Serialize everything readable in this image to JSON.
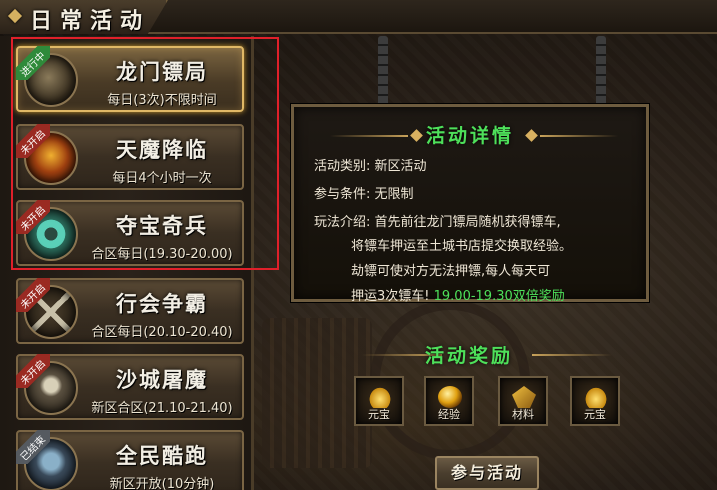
{
  "window_title": "日常活动",
  "activities": [
    {
      "name": "龙门镖局",
      "time": "每日(3次)不限时间",
      "status": "进行中",
      "icon": "cart-icon"
    },
    {
      "name": "天魔降临",
      "time": "每日4个小时一次",
      "status": "未开启",
      "icon": "demon-icon"
    },
    {
      "name": "夺宝奇兵",
      "time": "合区每日(19.30-20.00)",
      "status": "未开启",
      "icon": "treasure-icon"
    },
    {
      "name": "行会争霸",
      "time": "合区每日(20.10-20.40)",
      "status": "未开启",
      "icon": "crossed-swords-icon"
    },
    {
      "name": "沙城屠魔",
      "time": "新区合区(21.10-21.40)",
      "status": "未开启",
      "icon": "skull-icon"
    },
    {
      "name": "全民酷跑",
      "time": "新区开放(10分钟)",
      "status": "已结束",
      "icon": "runner-icon"
    }
  ],
  "detail": {
    "title": "活动详情",
    "category_label": "活动类别:",
    "category_value": "新区活动",
    "condition_label": "参与条件:",
    "condition_value": "无限制",
    "intro_label": "玩法介绍:",
    "intro_line1": "首先前往龙门镖局随机获得镖车,",
    "intro_line2": "将镖车押运至土城书店提交换取经验。",
    "intro_line3": "劫镖可使对方无法押镖,每人每天可",
    "intro_line4": "押运3次镖车!",
    "intro_highlight": "19.00-19.30双倍奖励"
  },
  "rewards": {
    "title": "活动奖励",
    "items": [
      {
        "label": "元宝",
        "icon": "gold-ingot-icon"
      },
      {
        "label": "经验",
        "icon": "exp-orb-icon"
      },
      {
        "label": "材料",
        "icon": "material-icon"
      },
      {
        "label": "元宝",
        "icon": "gold-ingot-icon"
      }
    ]
  },
  "join_button": "参与活动",
  "colors": {
    "highlight_green": "#4ee05a",
    "selection_red": "#e0202a",
    "active_border": "#e0b866"
  }
}
